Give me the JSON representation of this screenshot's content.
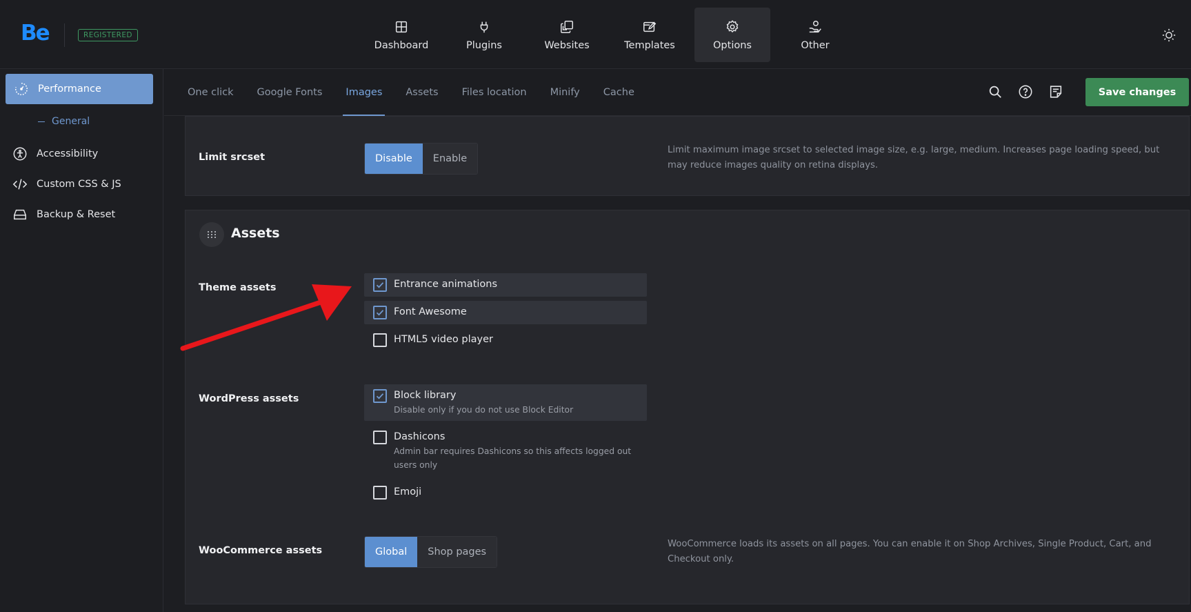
{
  "header": {
    "logo": "Be",
    "badge": "REGISTERED",
    "nav": [
      {
        "label": "Dashboard",
        "icon": "dashboard-icon"
      },
      {
        "label": "Plugins",
        "icon": "plug-icon"
      },
      {
        "label": "Websites",
        "icon": "websites-icon"
      },
      {
        "label": "Templates",
        "icon": "templates-icon"
      },
      {
        "label": "Options",
        "icon": "gear-icon",
        "active": true
      },
      {
        "label": "Other",
        "icon": "user-hand-icon"
      }
    ]
  },
  "sidebar": {
    "active": "Performance",
    "sub": "General",
    "items": [
      "Accessibility",
      "Custom CSS & JS",
      "Backup & Reset"
    ]
  },
  "tabs": {
    "items": [
      "One click",
      "Google Fonts",
      "Images",
      "Assets",
      "Files location",
      "Minify",
      "Cache"
    ],
    "active": "Images",
    "save_label": "Save changes"
  },
  "limit_srcset": {
    "label": "Limit srcset",
    "options": [
      "Disable",
      "Enable"
    ],
    "selected": "Disable",
    "description": "Limit maximum image srcset to selected image size, e.g. large, medium. Increases page loading speed, but may reduce images quality on retina displays."
  },
  "assets": {
    "title": "Assets",
    "theme_assets": {
      "label": "Theme assets",
      "items": [
        {
          "label": "Entrance animations",
          "checked": true
        },
        {
          "label": "Font Awesome",
          "checked": true
        },
        {
          "label": "HTML5 video player",
          "checked": false
        }
      ]
    },
    "wordpress_assets": {
      "label": "WordPress assets",
      "items": [
        {
          "label": "Block library",
          "hint": "Disable only if you do not use Block Editor",
          "checked": true
        },
        {
          "label": "Dashicons",
          "hint": "Admin bar requires Dashicons so this affects logged out users only",
          "checked": false
        },
        {
          "label": "Emoji",
          "checked": false
        }
      ]
    },
    "woocommerce_assets": {
      "label": "WooCommerce assets",
      "options": [
        "Global",
        "Shop pages"
      ],
      "selected": "Global",
      "description": "WooCommerce loads its assets on all pages. You can enable it on Shop Archives, Single Product, Cart, and Checkout only."
    }
  },
  "colors": {
    "accent": "#6f98cf",
    "save": "#3c8a55",
    "arrow": "#e8171b",
    "registered": "#3f9a62"
  }
}
